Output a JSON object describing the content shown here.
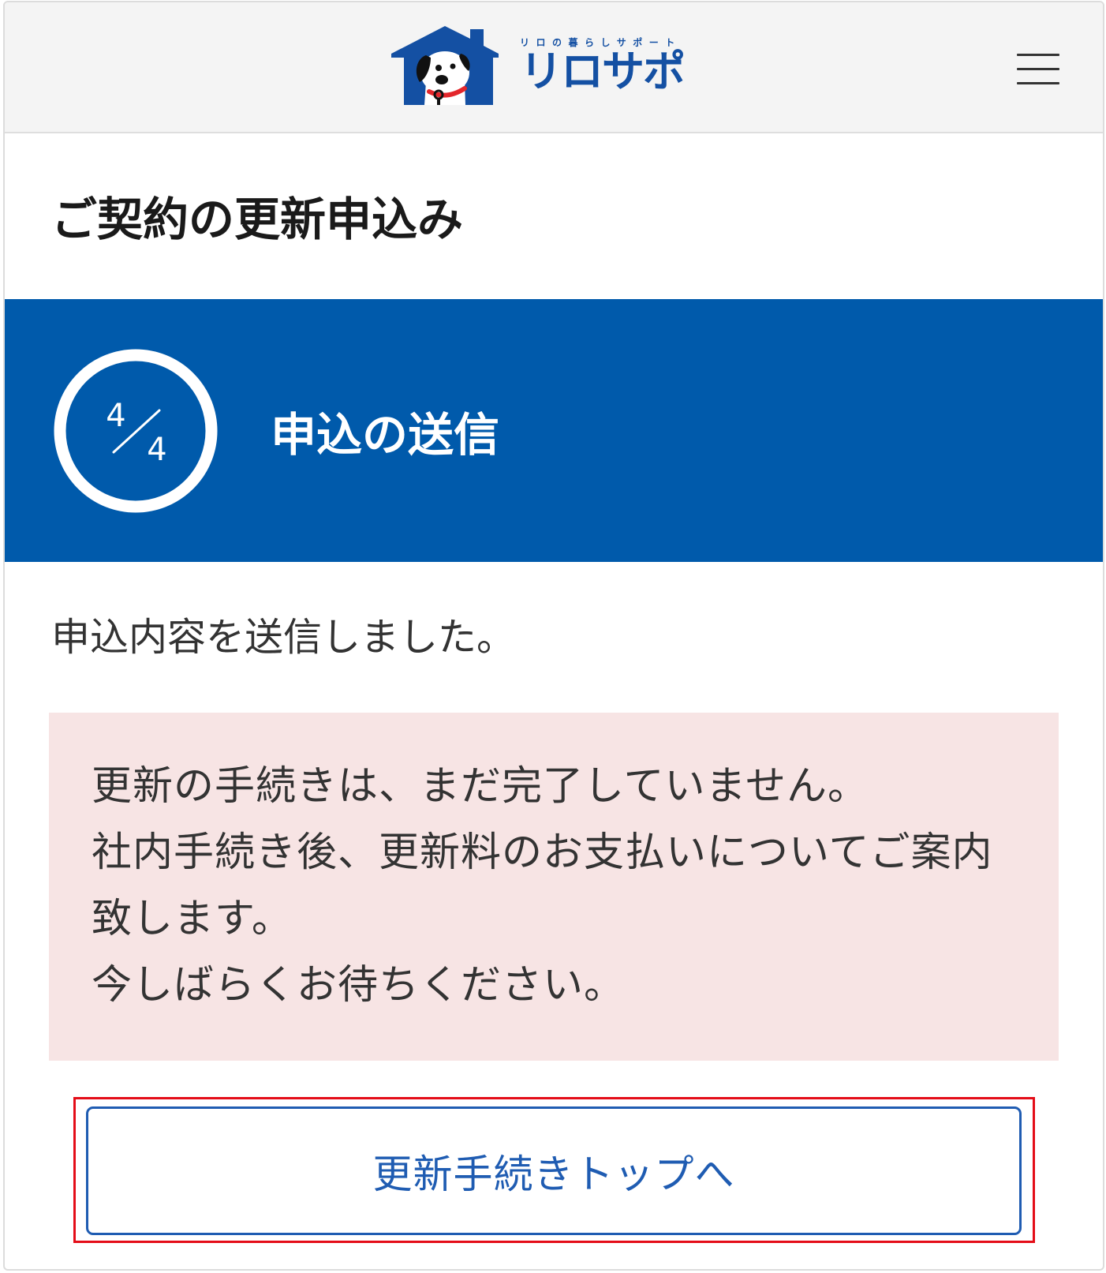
{
  "header": {
    "logo": {
      "icon": "house-dog-logo-icon",
      "tagline": "リロの暮らしサポート",
      "name": "リロサポ"
    },
    "menu_icon": "hamburger-menu-icon"
  },
  "page": {
    "title": "ご契約の更新申込み"
  },
  "step": {
    "current": 4,
    "total": 4,
    "label": "申込の送信"
  },
  "message": "申込内容を送信しました。",
  "notice": {
    "lines": [
      "更新の手続きは、まだ完了していません。",
      "社内手続き後、更新料のお支払いについてご案内致します。",
      "今しばらくお待ちください。"
    ]
  },
  "actions": {
    "top_button_label": "更新手続きトップへ"
  },
  "colors": {
    "brand_blue": "#005aab",
    "logo_blue": "#1450a3",
    "button_blue": "#1f5cb2",
    "notice_background": "#f7e4e4",
    "highlight_red": "#e40d18"
  }
}
